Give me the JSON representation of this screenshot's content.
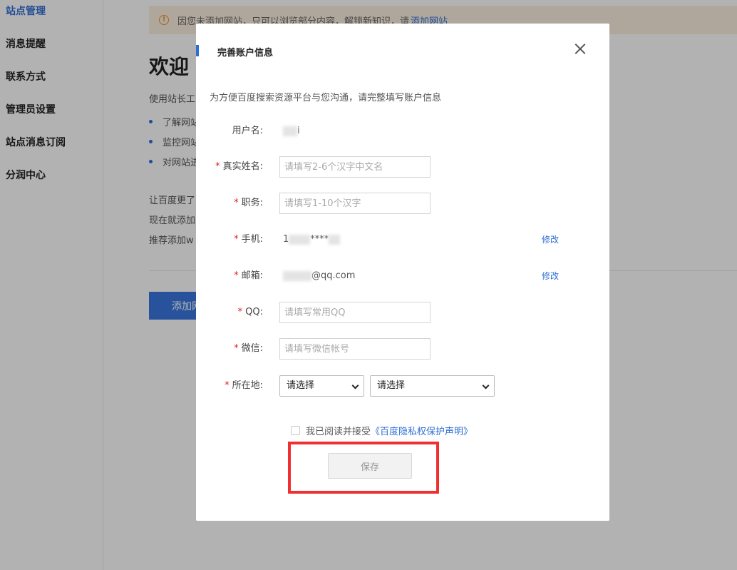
{
  "sidebar": {
    "items": [
      {
        "label": "站点管理"
      },
      {
        "label": "消息提醒"
      },
      {
        "label": "联系方式"
      },
      {
        "label": "管理员设置"
      },
      {
        "label": "站点消息订阅"
      },
      {
        "label": "分润中心"
      }
    ]
  },
  "notice": {
    "text": "因您未添加网站，只可以浏览部分内容，解锁新知识，请",
    "link": "添加网站"
  },
  "welcome": {
    "title": "欢迎",
    "desc": "使用站长工",
    "list": [
      "了解网站",
      "监控网站",
      "对网站进"
    ],
    "p1": "让百度更了",
    "p2": "现在就添加",
    "p3": "推荐添加w",
    "add_button": "添加网"
  },
  "modal": {
    "title": "完善账户信息",
    "intro": "为方便百度搜索资源平台与您沟通，请完整填写账户信息",
    "fields": {
      "username": {
        "label": "用户名:",
        "value": "i"
      },
      "realname": {
        "label": "真实姓名:",
        "placeholder": "请填写2-6个汉字中文名"
      },
      "position": {
        "label": "职务:",
        "placeholder": "请填写1-10个汉字"
      },
      "phone": {
        "label": "手机:",
        "value": "1",
        "value2": "****",
        "action": "修改"
      },
      "email": {
        "label": "邮箱:",
        "value": "",
        "value2": "@qq.com",
        "action": "修改"
      },
      "qq": {
        "label": "QQ:",
        "placeholder": "请填写常用QQ"
      },
      "wechat": {
        "label": "微信:",
        "placeholder": "请填写微信帐号"
      },
      "location": {
        "label": "所在地:",
        "province": "请选择",
        "city": "请选择"
      }
    },
    "agree_text": "我已阅读并接受",
    "agree_link": "《百度隐私权保护声明》",
    "save_label": "保存",
    "required_mark": "*"
  }
}
